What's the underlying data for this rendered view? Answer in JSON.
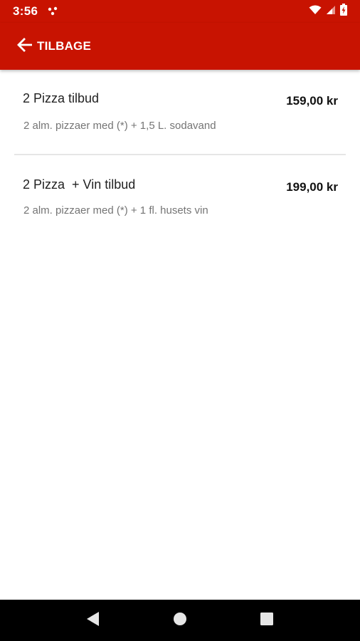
{
  "status_bar": {
    "time": "3:56",
    "notification_icon": "dots-notification-icon",
    "wifi_icon": "wifi-icon",
    "signal_icon": "cell-signal-icon",
    "battery_icon": "battery-charging-icon"
  },
  "app_bar": {
    "back_icon": "arrow-left-icon",
    "back_label": "TILBAGE"
  },
  "offers": [
    {
      "title": "2 Pizza tilbud",
      "description": "2 alm. pizzaer med (*) + 1,5 L. sodavand",
      "price": "159,00 kr"
    },
    {
      "title": "2 Pizza  + Vin tilbud",
      "description": "2 alm. pizzaer med (*) + 1 fl. husets vin",
      "price": "199,00 kr"
    }
  ],
  "nav_bar": {
    "back_icon": "triangle-back-icon",
    "home_icon": "circle-home-icon",
    "recents_icon": "square-recents-icon"
  },
  "colors": {
    "primary": "#c81301",
    "nav_bar": "#000000",
    "title_text": "#222222",
    "secondary_text": "#757575",
    "divider": "#e6e6e6"
  }
}
